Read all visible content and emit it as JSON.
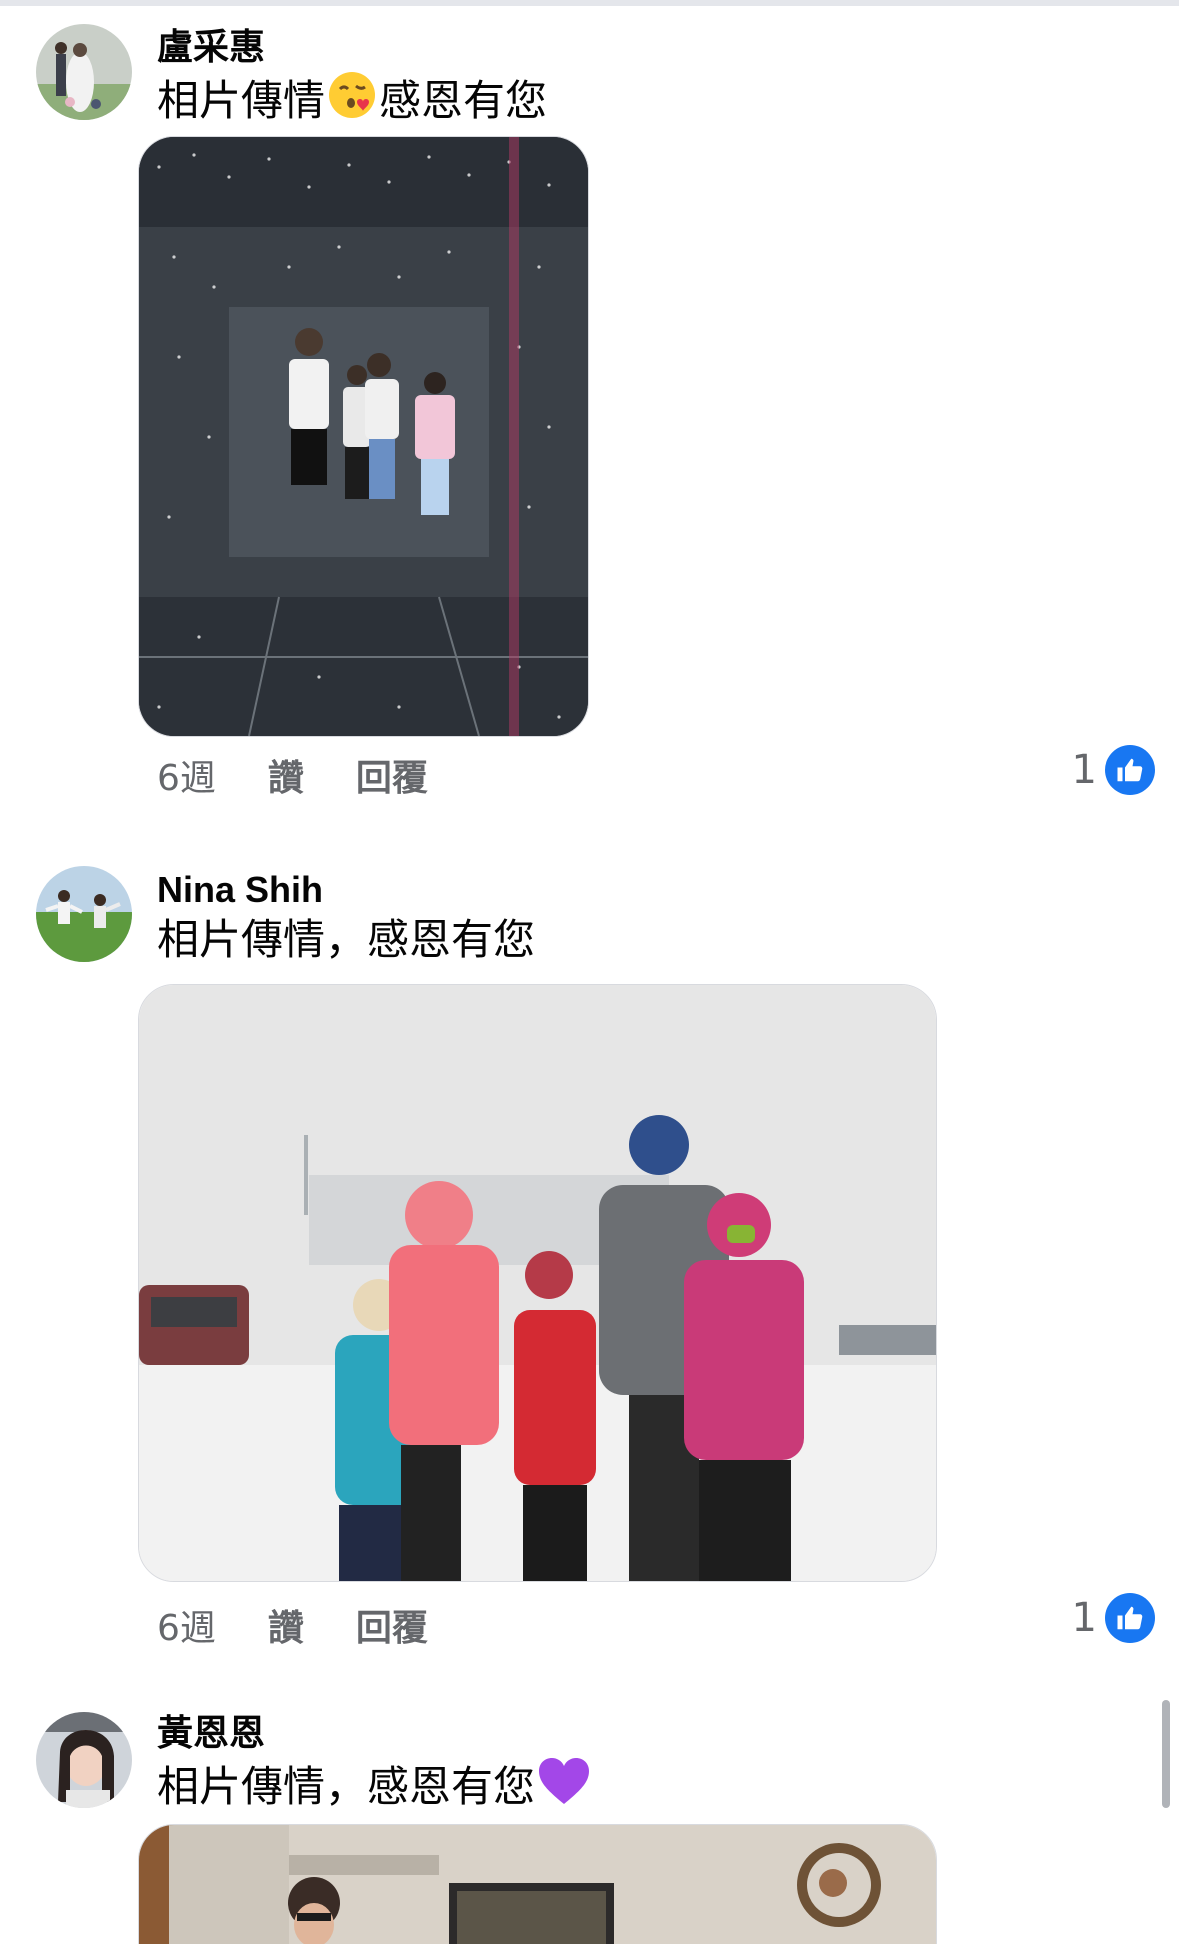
{
  "comments": [
    {
      "author": "盧采惠",
      "text_before": "相片傳情",
      "emoji": "face-blowing-kiss",
      "text_after": "感恩有您",
      "time": "6週",
      "like_label": "讚",
      "reply_label": "回覆",
      "reaction_count": "1",
      "reaction_icon": "thumbs-up-icon"
    },
    {
      "author": "Nina Shih",
      "text": "相片傳情，感恩有您",
      "time": "6週",
      "like_label": "讚",
      "reply_label": "回覆",
      "reaction_count": "1",
      "reaction_icon": "thumbs-up-icon"
    },
    {
      "author": "黃恩恩",
      "text": "相片傳情，感恩有您",
      "emoji": "purple-heart"
    }
  ],
  "colors": {
    "like_blue": "#1877f2",
    "secondary_text": "#65676b",
    "purple_heart": "#a347e8"
  }
}
